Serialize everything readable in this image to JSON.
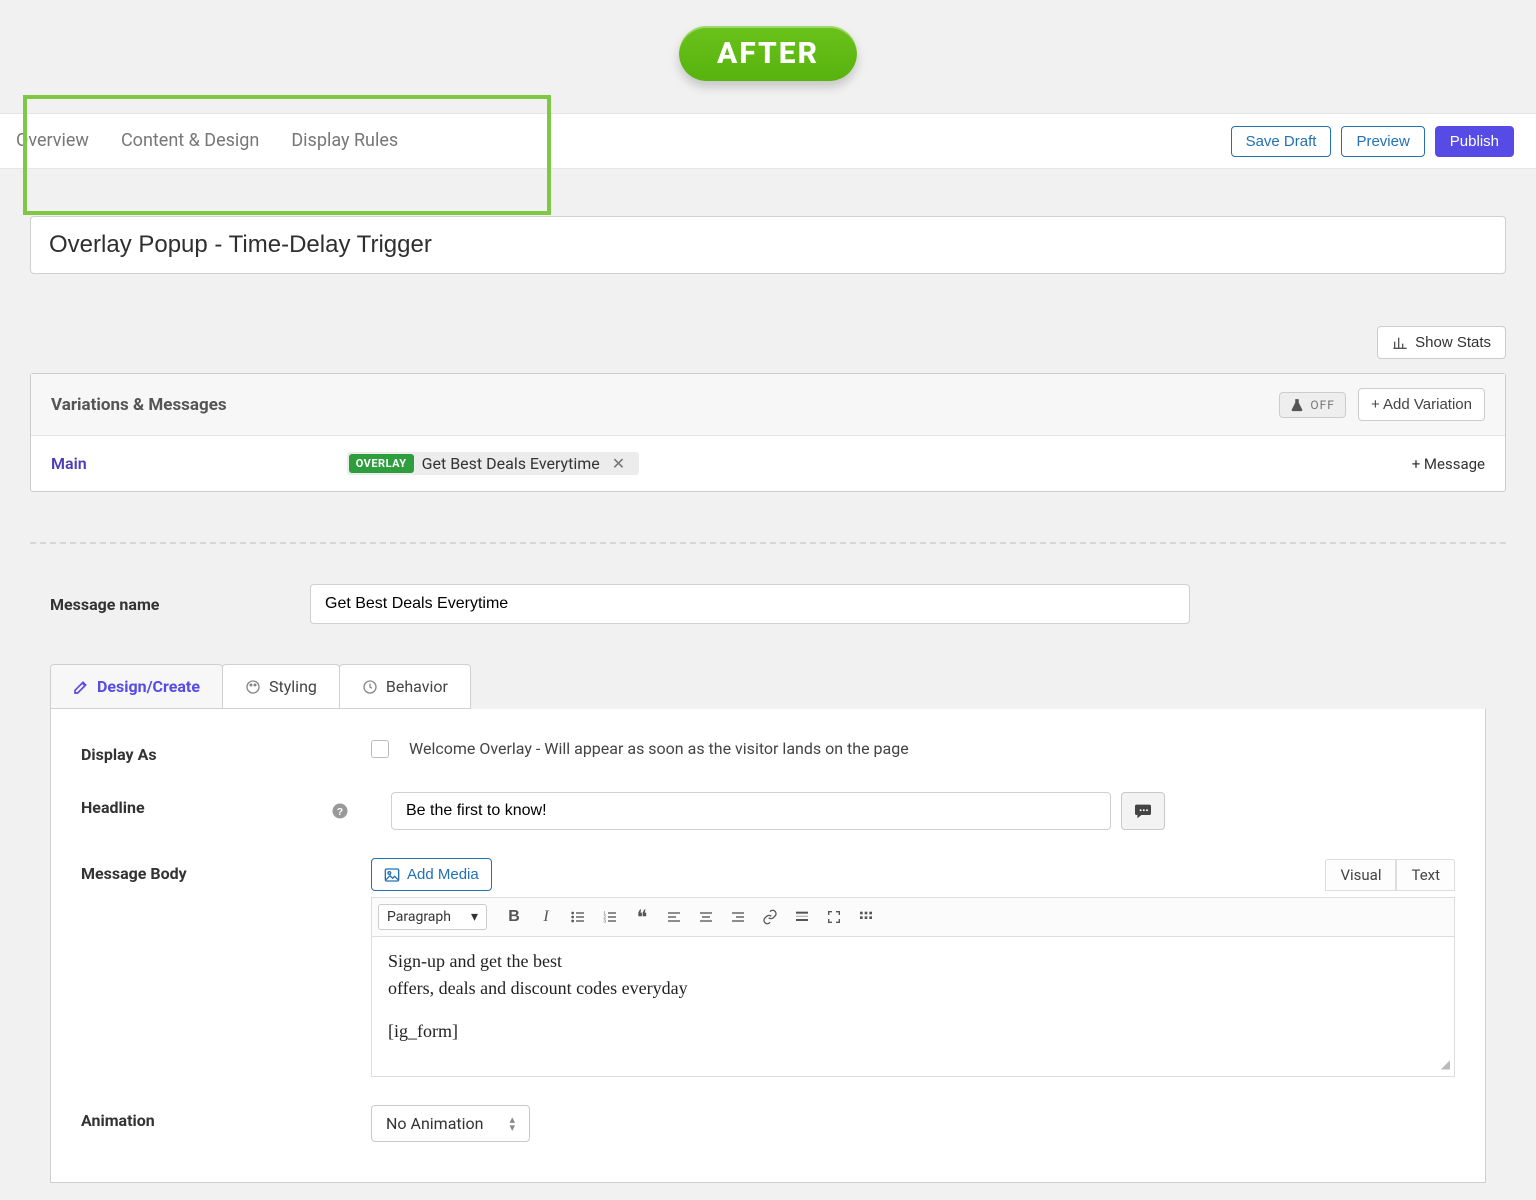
{
  "badge_label": "AFTER",
  "nav": {
    "overview": "Overview",
    "content": "Content & Design",
    "rules": "Display Rules"
  },
  "actions": {
    "save": "Save Draft",
    "preview": "Preview",
    "publish": "Publish"
  },
  "title": "Overlay Popup - Time-Delay Trigger",
  "stats_btn": "Show Stats",
  "variations": {
    "heading": "Variations & Messages",
    "off": "OFF",
    "add_variation": "Add Variation",
    "main_label": "Main",
    "message": {
      "tag": "OVERLAY",
      "text": "Get Best Deals Everytime"
    },
    "add_message": "Message"
  },
  "msg_name": {
    "label": "Message name",
    "value": "Get Best Deals Everytime"
  },
  "tabs": {
    "design": "Design/Create",
    "styling": "Styling",
    "behavior": "Behavior"
  },
  "display_as": {
    "label": "Display As",
    "checkbox": "Welcome Overlay - Will appear as soon as the visitor lands on the page"
  },
  "headline": {
    "label": "Headline",
    "value": "Be the first to know!"
  },
  "body": {
    "label": "Message Body",
    "add_media": "Add Media",
    "visual": "Visual",
    "text": "Text",
    "paragraph": "Paragraph",
    "line1": "Sign-up and get the best",
    "line2": "offers, deals and discount codes everyday",
    "line3": "[ig_form]"
  },
  "animation": {
    "label": "Animation",
    "value": "No Animation"
  }
}
